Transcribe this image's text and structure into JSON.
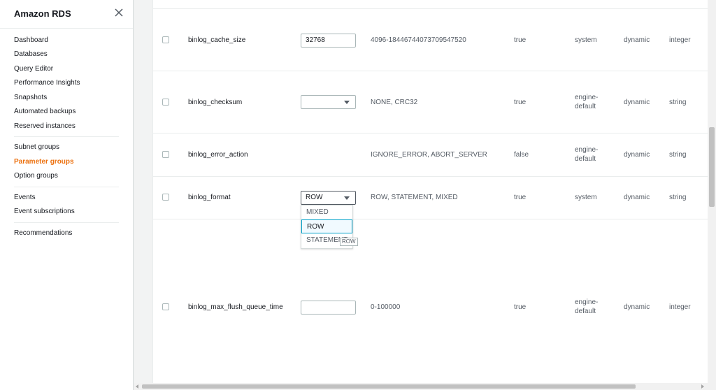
{
  "sidebar": {
    "title": "Amazon RDS",
    "close_icon": "close-icon",
    "items": [
      {
        "label": "Dashboard"
      },
      {
        "label": "Databases"
      },
      {
        "label": "Query Editor"
      },
      {
        "label": "Performance Insights"
      },
      {
        "label": "Snapshots"
      },
      {
        "label": "Automated backups"
      },
      {
        "label": "Reserved instances"
      },
      {
        "label": "Subnet groups"
      },
      {
        "label": "Parameter groups",
        "active": true
      },
      {
        "label": "Option groups"
      },
      {
        "label": "Events"
      },
      {
        "label": "Event subscriptions"
      },
      {
        "label": "Recommendations"
      }
    ]
  },
  "accent_color": "#ec7211",
  "parameters": [
    {
      "name": "binlog_cache_size",
      "value_type": "text",
      "value": "32768",
      "allowed": "4096-18446744073709547520",
      "modifiable": "true",
      "source": "system",
      "apply_type": "dynamic",
      "data_type": "integer"
    },
    {
      "name": "binlog_checksum",
      "value_type": "select",
      "value": "",
      "allowed": "NONE, CRC32",
      "modifiable": "true",
      "source": "engine-default",
      "apply_type": "dynamic",
      "data_type": "string"
    },
    {
      "name": "binlog_error_action",
      "value_type": "none",
      "value": "",
      "allowed": "IGNORE_ERROR, ABORT_SERVER",
      "modifiable": "false",
      "source": "engine-default",
      "apply_type": "dynamic",
      "data_type": "string"
    },
    {
      "name": "binlog_format",
      "value_type": "select",
      "value": "ROW",
      "allowed": "ROW, STATEMENT, MIXED",
      "modifiable": "true",
      "source": "system",
      "apply_type": "dynamic",
      "data_type": "string"
    },
    {
      "name": "binlog_max_flush_queue_time",
      "value_type": "text",
      "value": "",
      "allowed": "0-100000",
      "modifiable": "true",
      "source": "engine-default",
      "apply_type": "dynamic",
      "data_type": "integer"
    }
  ],
  "dropdown": {
    "options": [
      "MIXED",
      "ROW",
      "STATEMENT"
    ],
    "selected": "ROW",
    "tooltip": "ROW"
  }
}
